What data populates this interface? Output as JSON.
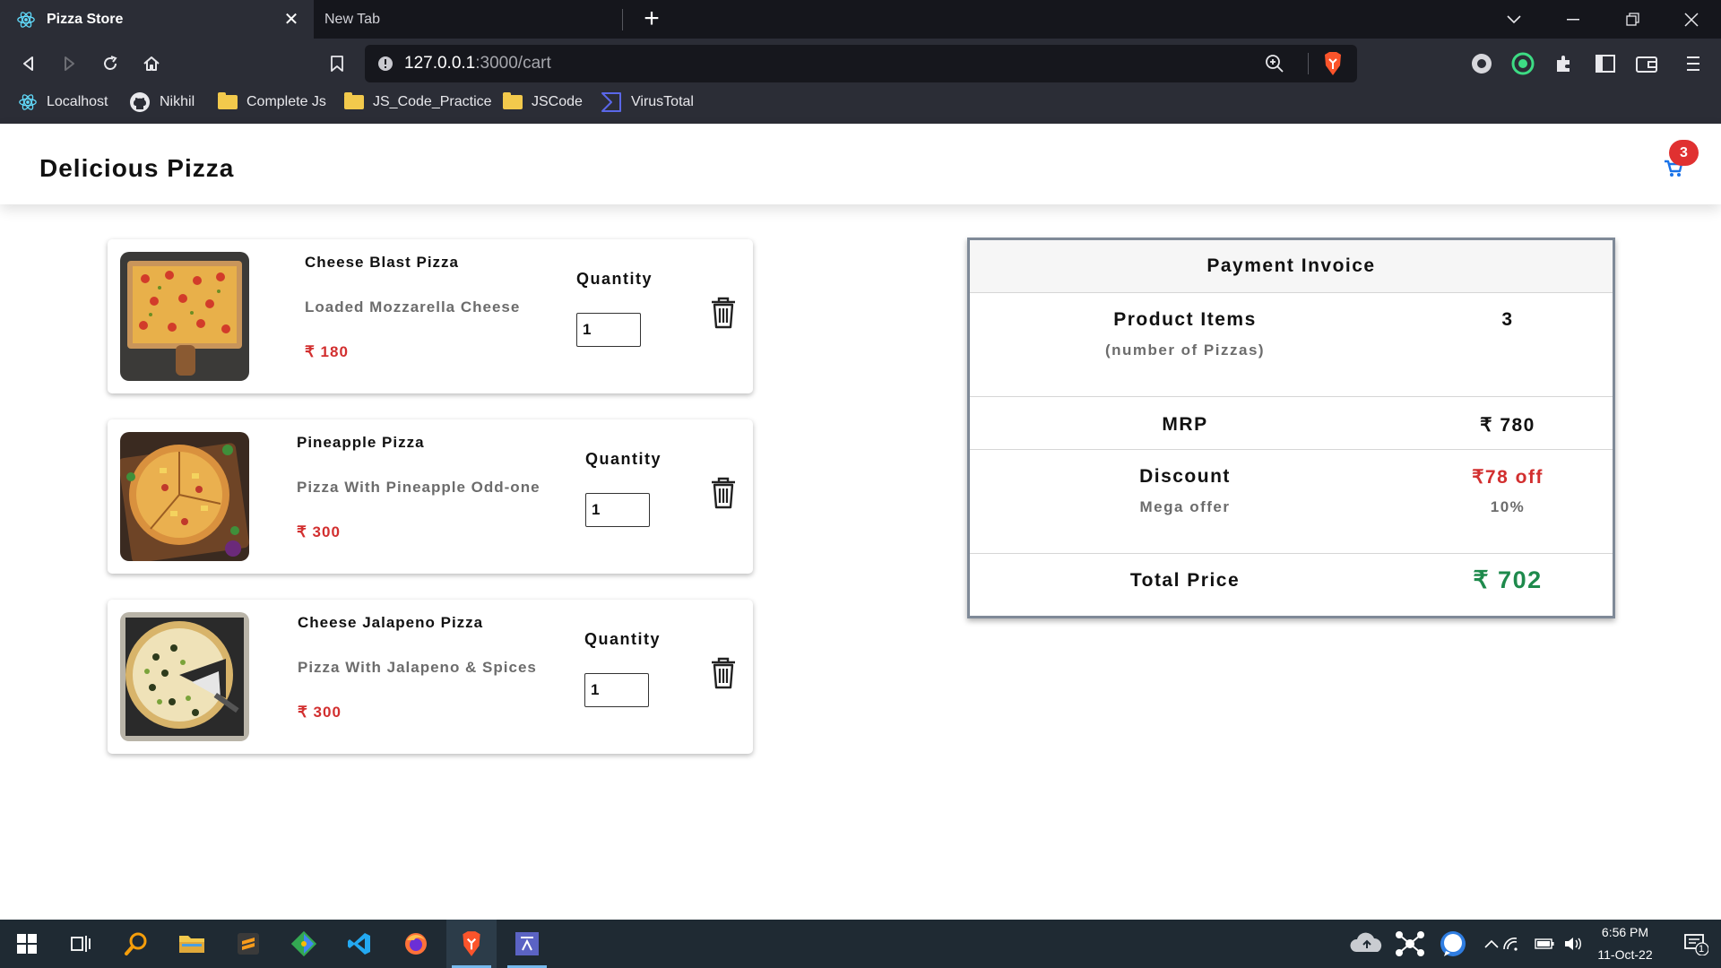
{
  "browser": {
    "active_tab": {
      "title": "Pizza Store",
      "icon": "react-atom-icon"
    },
    "inactive_tab": {
      "title": "New Tab"
    },
    "url": {
      "host": "127.0.0.1",
      "path": ":3000/cart"
    },
    "bookmarks": [
      {
        "label": "Localhost",
        "icon": "react-atom-icon"
      },
      {
        "label": "Nikhil",
        "icon": "github-icon"
      },
      {
        "label": "Complete Js",
        "icon": "folder-icon"
      },
      {
        "label": "JS_Code_Practice",
        "icon": "folder-icon"
      },
      {
        "label": "JSCode",
        "icon": "folder-icon"
      },
      {
        "label": "VirusTotal",
        "icon": "virustotal-icon"
      }
    ]
  },
  "site": {
    "brand": "Delicious Pizza",
    "cart_count": "3"
  },
  "cart": {
    "items": [
      {
        "name": "Cheese Blast Pizza",
        "description": "Loaded Mozzarella Cheese",
        "price": "₹ 180",
        "quantity_label": "Quantity",
        "quantity": "1"
      },
      {
        "name": "Pineapple Pizza",
        "description": "Pizza With Pineapple Odd-one",
        "price": "₹ 300",
        "quantity_label": "Quantity",
        "quantity": "1"
      },
      {
        "name": "Cheese Jalapeno Pizza",
        "description": "Pizza With Jalapeno & Spices",
        "price": "₹ 300",
        "quantity_label": "Quantity",
        "quantity": "1"
      }
    ]
  },
  "invoice": {
    "title": "Payment Invoice",
    "product_items_label": "Product Items",
    "product_items_sub": "(number of Pizzas)",
    "product_items_value": "3",
    "mrp_label": "MRP",
    "mrp_value": "₹ 780",
    "discount_label": "Discount",
    "discount_sub": "Mega offer",
    "discount_value": "₹78 off",
    "discount_percent": "10%",
    "total_label": "Total Price",
    "total_value": "₹ 702",
    "colors": {
      "discount": "#d22f2f",
      "total": "#1e8a4c"
    }
  },
  "taskbar": {
    "time": "6:56 PM",
    "date": "11-Oct-22",
    "notification_count": "1"
  }
}
